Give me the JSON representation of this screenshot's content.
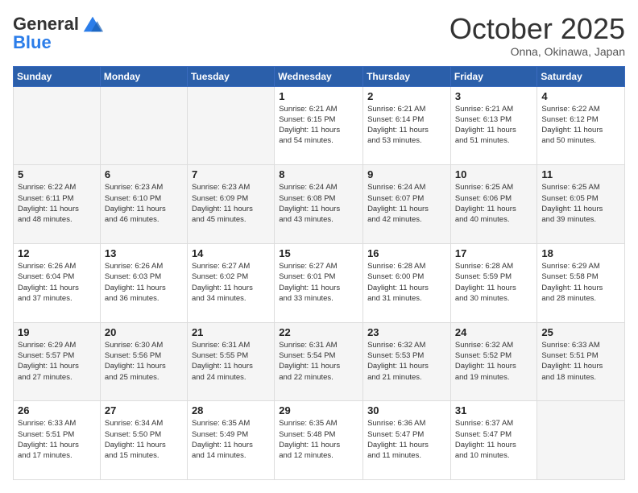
{
  "header": {
    "logo_general": "General",
    "logo_blue": "Blue",
    "month": "October 2025",
    "location": "Onna, Okinawa, Japan"
  },
  "days_of_week": [
    "Sunday",
    "Monday",
    "Tuesday",
    "Wednesday",
    "Thursday",
    "Friday",
    "Saturday"
  ],
  "weeks": [
    [
      {
        "day": "",
        "info": ""
      },
      {
        "day": "",
        "info": ""
      },
      {
        "day": "",
        "info": ""
      },
      {
        "day": "1",
        "info": "Sunrise: 6:21 AM\nSunset: 6:15 PM\nDaylight: 11 hours\nand 54 minutes."
      },
      {
        "day": "2",
        "info": "Sunrise: 6:21 AM\nSunset: 6:14 PM\nDaylight: 11 hours\nand 53 minutes."
      },
      {
        "day": "3",
        "info": "Sunrise: 6:21 AM\nSunset: 6:13 PM\nDaylight: 11 hours\nand 51 minutes."
      },
      {
        "day": "4",
        "info": "Sunrise: 6:22 AM\nSunset: 6:12 PM\nDaylight: 11 hours\nand 50 minutes."
      }
    ],
    [
      {
        "day": "5",
        "info": "Sunrise: 6:22 AM\nSunset: 6:11 PM\nDaylight: 11 hours\nand 48 minutes."
      },
      {
        "day": "6",
        "info": "Sunrise: 6:23 AM\nSunset: 6:10 PM\nDaylight: 11 hours\nand 46 minutes."
      },
      {
        "day": "7",
        "info": "Sunrise: 6:23 AM\nSunset: 6:09 PM\nDaylight: 11 hours\nand 45 minutes."
      },
      {
        "day": "8",
        "info": "Sunrise: 6:24 AM\nSunset: 6:08 PM\nDaylight: 11 hours\nand 43 minutes."
      },
      {
        "day": "9",
        "info": "Sunrise: 6:24 AM\nSunset: 6:07 PM\nDaylight: 11 hours\nand 42 minutes."
      },
      {
        "day": "10",
        "info": "Sunrise: 6:25 AM\nSunset: 6:06 PM\nDaylight: 11 hours\nand 40 minutes."
      },
      {
        "day": "11",
        "info": "Sunrise: 6:25 AM\nSunset: 6:05 PM\nDaylight: 11 hours\nand 39 minutes."
      }
    ],
    [
      {
        "day": "12",
        "info": "Sunrise: 6:26 AM\nSunset: 6:04 PM\nDaylight: 11 hours\nand 37 minutes."
      },
      {
        "day": "13",
        "info": "Sunrise: 6:26 AM\nSunset: 6:03 PM\nDaylight: 11 hours\nand 36 minutes."
      },
      {
        "day": "14",
        "info": "Sunrise: 6:27 AM\nSunset: 6:02 PM\nDaylight: 11 hours\nand 34 minutes."
      },
      {
        "day": "15",
        "info": "Sunrise: 6:27 AM\nSunset: 6:01 PM\nDaylight: 11 hours\nand 33 minutes."
      },
      {
        "day": "16",
        "info": "Sunrise: 6:28 AM\nSunset: 6:00 PM\nDaylight: 11 hours\nand 31 minutes."
      },
      {
        "day": "17",
        "info": "Sunrise: 6:28 AM\nSunset: 5:59 PM\nDaylight: 11 hours\nand 30 minutes."
      },
      {
        "day": "18",
        "info": "Sunrise: 6:29 AM\nSunset: 5:58 PM\nDaylight: 11 hours\nand 28 minutes."
      }
    ],
    [
      {
        "day": "19",
        "info": "Sunrise: 6:29 AM\nSunset: 5:57 PM\nDaylight: 11 hours\nand 27 minutes."
      },
      {
        "day": "20",
        "info": "Sunrise: 6:30 AM\nSunset: 5:56 PM\nDaylight: 11 hours\nand 25 minutes."
      },
      {
        "day": "21",
        "info": "Sunrise: 6:31 AM\nSunset: 5:55 PM\nDaylight: 11 hours\nand 24 minutes."
      },
      {
        "day": "22",
        "info": "Sunrise: 6:31 AM\nSunset: 5:54 PM\nDaylight: 11 hours\nand 22 minutes."
      },
      {
        "day": "23",
        "info": "Sunrise: 6:32 AM\nSunset: 5:53 PM\nDaylight: 11 hours\nand 21 minutes."
      },
      {
        "day": "24",
        "info": "Sunrise: 6:32 AM\nSunset: 5:52 PM\nDaylight: 11 hours\nand 19 minutes."
      },
      {
        "day": "25",
        "info": "Sunrise: 6:33 AM\nSunset: 5:51 PM\nDaylight: 11 hours\nand 18 minutes."
      }
    ],
    [
      {
        "day": "26",
        "info": "Sunrise: 6:33 AM\nSunset: 5:51 PM\nDaylight: 11 hours\nand 17 minutes."
      },
      {
        "day": "27",
        "info": "Sunrise: 6:34 AM\nSunset: 5:50 PM\nDaylight: 11 hours\nand 15 minutes."
      },
      {
        "day": "28",
        "info": "Sunrise: 6:35 AM\nSunset: 5:49 PM\nDaylight: 11 hours\nand 14 minutes."
      },
      {
        "day": "29",
        "info": "Sunrise: 6:35 AM\nSunset: 5:48 PM\nDaylight: 11 hours\nand 12 minutes."
      },
      {
        "day": "30",
        "info": "Sunrise: 6:36 AM\nSunset: 5:47 PM\nDaylight: 11 hours\nand 11 minutes."
      },
      {
        "day": "31",
        "info": "Sunrise: 6:37 AM\nSunset: 5:47 PM\nDaylight: 11 hours\nand 10 minutes."
      },
      {
        "day": "",
        "info": ""
      }
    ]
  ]
}
